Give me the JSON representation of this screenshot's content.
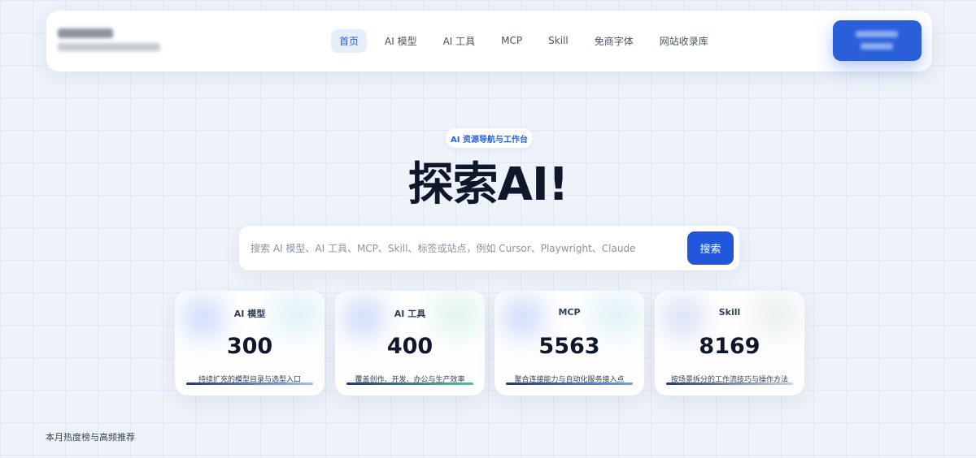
{
  "header": {
    "nav": [
      {
        "label": "首页",
        "active": true
      },
      {
        "label": "AI 模型",
        "active": false
      },
      {
        "label": "AI 工具",
        "active": false
      },
      {
        "label": "MCP",
        "active": false
      },
      {
        "label": "Skill",
        "active": false
      },
      {
        "label": "免商字体",
        "active": false
      },
      {
        "label": "网站收录库",
        "active": false
      }
    ]
  },
  "hero": {
    "badge": "AI 资源导航与工作台",
    "title": "探索AI!"
  },
  "search": {
    "placeholder": "搜索 AI 模型、AI 工具、MCP、Skill、标签或站点，例如 Cursor、Playwright、Claude",
    "button_label": "搜索"
  },
  "stats": [
    {
      "title": "AI 模型",
      "value": "300",
      "desc": "持续扩充的模型目录与选型入口",
      "bar_from": "#1e3a8a",
      "bar_to": "#93c5fd"
    },
    {
      "title": "AI 工具",
      "value": "400",
      "desc": "覆盖创作、开发、办公与生产效率",
      "bar_from": "#1e3a8a",
      "bar_to": "#34d399"
    },
    {
      "title": "MCP",
      "value": "5563",
      "desc": "聚合连接能力与自动化服务接入点",
      "bar_from": "#1e3a8a",
      "bar_to": "#60a5fa"
    },
    {
      "title": "Skill",
      "value": "8169",
      "desc": "按场景拆分的工作流技巧与操作方法",
      "bar_from": "#1e3a8a",
      "bar_to": "#cbd5e1"
    }
  ],
  "footer": {
    "section_label": "本月热度榜与高频推荐"
  },
  "colors": {
    "accent": "#2b5fd9",
    "background": "#eef2f9"
  }
}
